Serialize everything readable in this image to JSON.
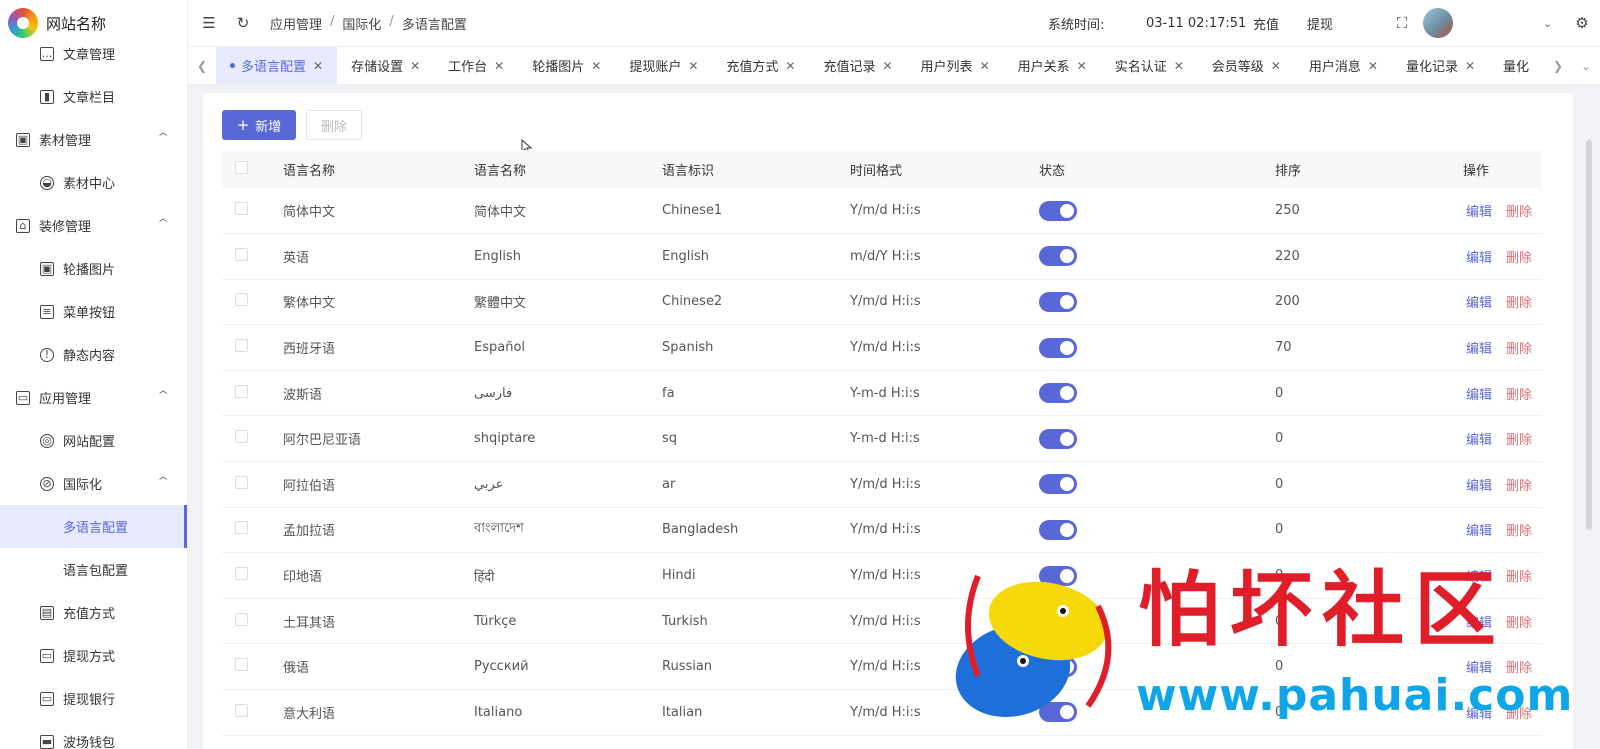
{
  "app": {
    "site_name": "网站名称"
  },
  "sidebar": {
    "items": [
      {
        "label": "文章管理",
        "level": 2,
        "icon": "chat-icon"
      },
      {
        "label": "文章栏目",
        "level": 2,
        "icon": "bookmark-icon"
      },
      {
        "label": "素材管理",
        "level": 1,
        "icon": "image-icon",
        "expanded": true
      },
      {
        "label": "素材中心",
        "level": 2,
        "icon": "gauge-icon"
      },
      {
        "label": "装修管理",
        "level": 1,
        "icon": "shop-icon",
        "expanded": true
      },
      {
        "label": "轮播图片",
        "level": 2,
        "icon": "image-icon"
      },
      {
        "label": "菜单按钮",
        "level": 2,
        "icon": "list-icon"
      },
      {
        "label": "静态内容",
        "level": 2,
        "icon": "info-icon"
      },
      {
        "label": "应用管理",
        "level": 1,
        "icon": "app-icon",
        "expanded": true
      },
      {
        "label": "网站配置",
        "level": 2,
        "icon": "dribbble-icon"
      },
      {
        "label": "国际化",
        "level": 2,
        "icon": "globe-icon",
        "expanded": true
      },
      {
        "label": "多语言配置",
        "level": 3,
        "active": true
      },
      {
        "label": "语言包配置",
        "level": 3
      },
      {
        "label": "充值方式",
        "level": 2,
        "icon": "wallet-icon"
      },
      {
        "label": "提现方式",
        "level": 2,
        "icon": "folder-icon"
      },
      {
        "label": "提现银行",
        "level": 2,
        "icon": "card-icon"
      },
      {
        "label": "波场钱包",
        "level": 2,
        "icon": "purse-icon"
      }
    ]
  },
  "header": {
    "breadcrumb": [
      "应用管理",
      "国际化",
      "多语言配置"
    ],
    "sys_time_label": "系统时间:",
    "sys_time": "03-11 02:17:51",
    "recharge": "充值",
    "withdraw": "提现"
  },
  "tabs": [
    {
      "label": "多语言配置",
      "active": true
    },
    {
      "label": "存储设置"
    },
    {
      "label": "工作台"
    },
    {
      "label": "轮播图片"
    },
    {
      "label": "提现账户"
    },
    {
      "label": "充值方式"
    },
    {
      "label": "充值记录"
    },
    {
      "label": "用户列表"
    },
    {
      "label": "用户关系"
    },
    {
      "label": "实名认证"
    },
    {
      "label": "会员等级"
    },
    {
      "label": "用户消息"
    },
    {
      "label": "量化记录"
    },
    {
      "label": "量化"
    }
  ],
  "toolbar": {
    "add_label": "新增",
    "delete_label": "删除"
  },
  "table": {
    "columns": [
      "语言名称",
      "语言名称",
      "语言标识",
      "时间格式",
      "状态",
      "排序",
      "操作"
    ],
    "edit_label": "编辑",
    "delete_label": "删除",
    "rows": [
      {
        "name": "简体中文",
        "native": "简体中文",
        "code": "Chinese1",
        "format": "Y/m/d H:i:s",
        "enabled": true,
        "sort": "250"
      },
      {
        "name": "英语",
        "native": "English",
        "code": "English",
        "format": "m/d/Y H:i:s",
        "enabled": true,
        "sort": "220"
      },
      {
        "name": "繁体中文",
        "native": "繁體中文",
        "code": "Chinese2",
        "format": "Y/m/d H:i:s",
        "enabled": true,
        "sort": "200"
      },
      {
        "name": "西班牙语",
        "native": "Español",
        "code": "Spanish",
        "format": "Y/m/d H:i:s",
        "enabled": true,
        "sort": "70"
      },
      {
        "name": "波斯语",
        "native": "فارسی",
        "code": "fa",
        "format": "Y-m-d H:i:s",
        "enabled": true,
        "sort": "0"
      },
      {
        "name": "阿尔巴尼亚语",
        "native": "shqiptare",
        "code": "sq",
        "format": "Y-m-d H:i:s",
        "enabled": true,
        "sort": "0"
      },
      {
        "name": "阿拉伯语",
        "native": "عربي",
        "code": "ar",
        "format": "Y/m/d H:i:s",
        "enabled": true,
        "sort": "0"
      },
      {
        "name": "孟加拉语",
        "native": "বাংলাদেশ",
        "code": "Bangladesh",
        "format": "Y/m/d H:i:s",
        "enabled": true,
        "sort": "0"
      },
      {
        "name": "印地语",
        "native": "हिंदी",
        "code": "Hindi",
        "format": "Y/m/d H:i:s",
        "enabled": true,
        "sort": "0"
      },
      {
        "name": "土耳其语",
        "native": "Türkçe",
        "code": "Turkish",
        "format": "Y/m/d H:i:s",
        "enabled": true,
        "sort": "0"
      },
      {
        "name": "俄语",
        "native": "Русский",
        "code": "Russian",
        "format": "Y/m/d H:i:s",
        "enabled": true,
        "sort": "0"
      },
      {
        "name": "意大利语",
        "native": "Italiano",
        "code": "Italian",
        "format": "Y/m/d H:i:s",
        "enabled": true,
        "sort": "0"
      }
    ]
  },
  "watermark": {
    "title": "怕坏社区",
    "url": "www.pahuai.com"
  },
  "colors": {
    "accent": "#5a67d8",
    "danger": "#e06c75",
    "wm_red": "#e01e2a",
    "wm_blue": "#0ea5e9"
  }
}
